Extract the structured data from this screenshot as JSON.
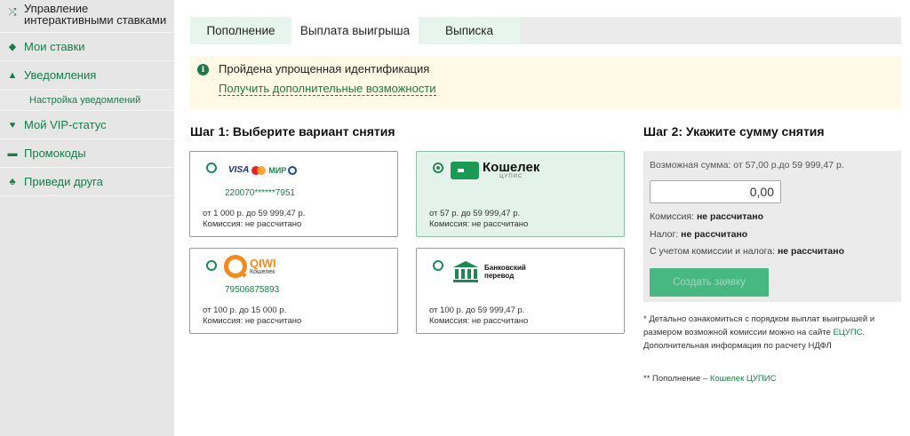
{
  "sidebar": {
    "items": [
      {
        "label": "Управление интерактивными ставками",
        "icon": "interactive-icon"
      },
      {
        "label": "Мои ставки",
        "icon": "ticket-icon"
      },
      {
        "label": "Уведомления",
        "icon": "bell-icon"
      },
      {
        "label": "Настройка уведомлений"
      },
      {
        "label": "Мой VIP-статус",
        "icon": "heart-icon"
      },
      {
        "label": "Промокоды",
        "icon": "promo-icon"
      },
      {
        "label": "Приведи друга",
        "icon": "user-plus-icon"
      }
    ]
  },
  "tabs": [
    "Пополнение",
    "Выплата выигрыша",
    "Выписка"
  ],
  "notice": {
    "text": "Пройдена упрощенная идентификация",
    "link": "Получить дополнительные возможности"
  },
  "step1": {
    "title": "Шаг 1: Выберите вариант снятия",
    "options": [
      {
        "logo": "cards",
        "visa": "VISA",
        "mir": "МИР",
        "number": "220070******7951",
        "range": "от 1 000 р. до 59 999,47 р.",
        "commission": "Комиссия: не рассчитано"
      },
      {
        "logo": "koshelek",
        "name": "Кошелек",
        "sub": "ЦУПИС",
        "range": "от 57 р. до 59 999,47 р.",
        "commission": "Комиссия: не рассчитано"
      },
      {
        "logo": "qiwi",
        "name": "QIWI",
        "sub": "Кошелек",
        "number": "79506875893",
        "range": "от 100 р. до 15 000 р.",
        "commission": "Комиссия: не рассчитано"
      },
      {
        "logo": "bank",
        "name_line1": "Банковский",
        "name_line2": "перевод",
        "range": "от 100 р. до 59 999,47 р.",
        "commission": "Комиссия: не рассчитано"
      }
    ]
  },
  "step2": {
    "title": "Шаг 2: Укажите сумму снятия",
    "available": "Возможная сумма: от 57,00 р.до 59 999,47 р.",
    "amount": "0,00",
    "commission_label": "Комиссия: ",
    "commission_value": "не рассчитано",
    "tax_label": "Налог: ",
    "tax_value": "не рассчитано",
    "total_label": "С учетом комиссии и налога: ",
    "total_value": "не рассчитано",
    "button": "Создать заявку"
  },
  "notes": {
    "note1_a": "* Детально ознакомиться с порядком выплат выигрышей и размером возможной комиссии можно на сайте ",
    "note1_link": "ЕЦУПС",
    "note1_b": ". Дополнительная информация по расчету НДФЛ",
    "note2_a": "** Пополнение – ",
    "note2_link": "Кошелек ЦУПИС"
  },
  "colors": {
    "accent": "#1a7a4a",
    "button": "#47b882",
    "notice_bg": "#fff9e5",
    "qiwi": "#f28b1e"
  }
}
